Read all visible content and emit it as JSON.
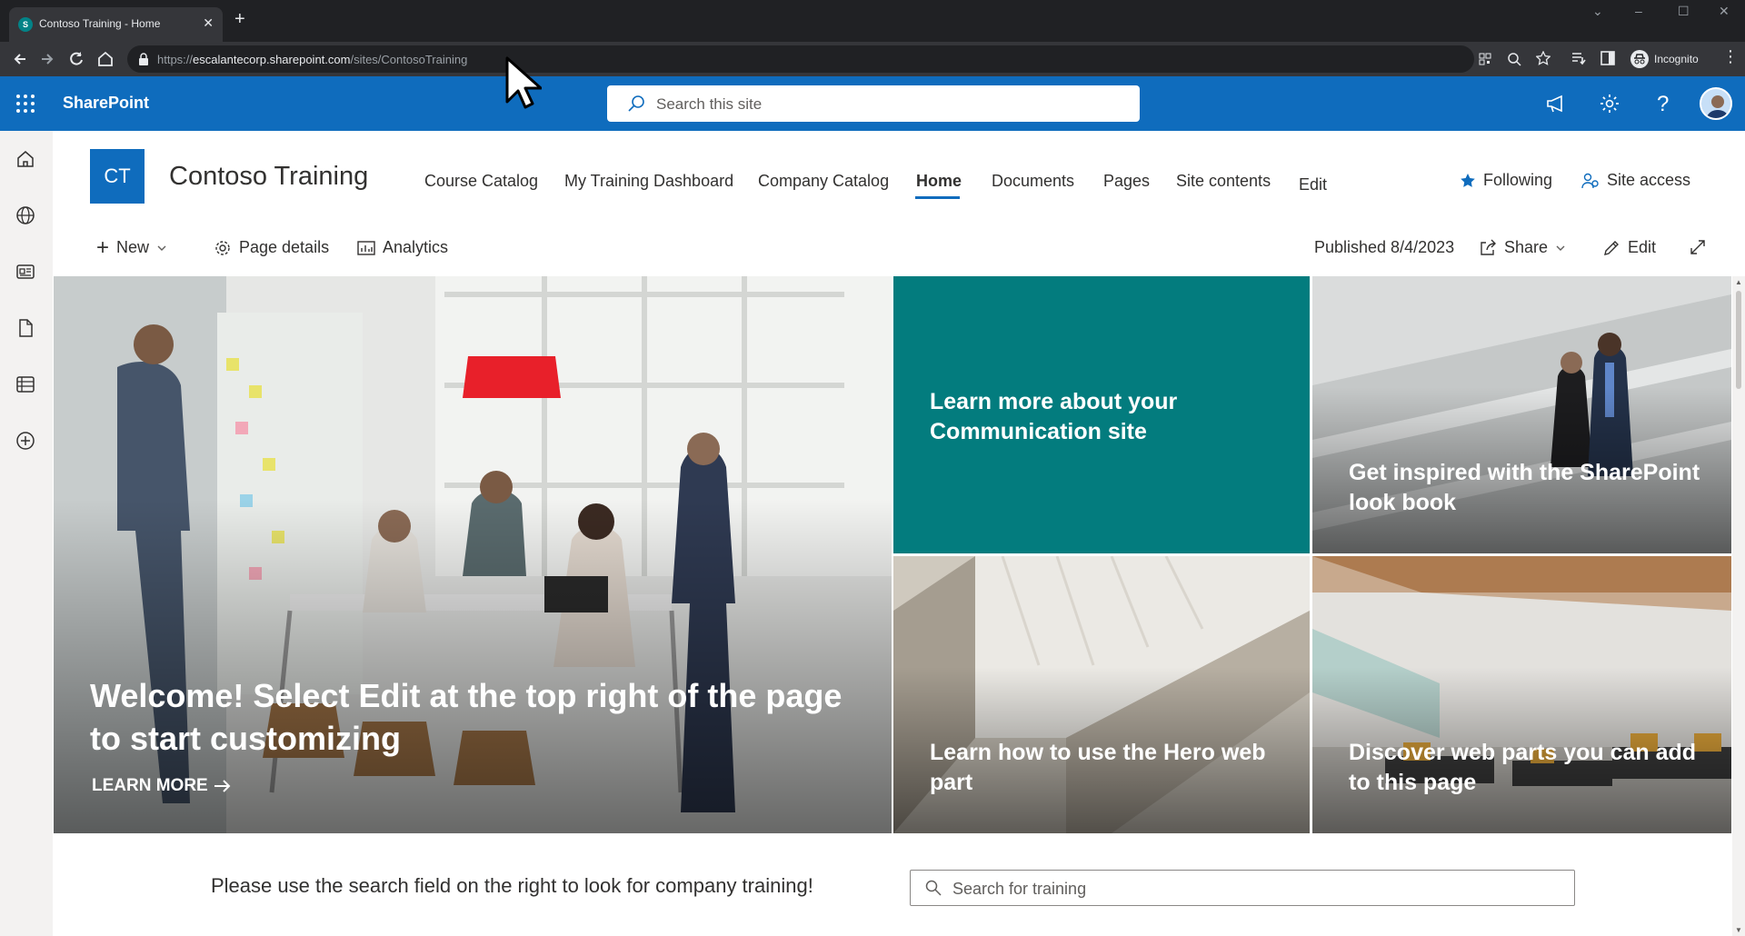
{
  "browser": {
    "tab_title": "Contoso Training - Home",
    "tab_favicon_text": "S",
    "url_prefix": "https://",
    "url_host": "escalantecorp.sharepoint.com",
    "url_path": "/sites/ContosoTraining",
    "profile_label": "Incognito"
  },
  "suitebar": {
    "brand": "SharePoint",
    "search_placeholder": "Search this site"
  },
  "site": {
    "logo_initials": "CT",
    "title": "Contoso Training",
    "nav": [
      {
        "label": "Course Catalog"
      },
      {
        "label": "My Training Dashboard"
      },
      {
        "label": "Company Catalog"
      },
      {
        "label": "Home",
        "active": true
      },
      {
        "label": "Documents"
      },
      {
        "label": "Pages"
      },
      {
        "label": "Site contents"
      },
      {
        "label": "Edit"
      }
    ],
    "following_label": "Following",
    "site_access_label": "Site access"
  },
  "commandbar": {
    "new_label": "New",
    "page_details_label": "Page details",
    "analytics_label": "Analytics",
    "published_label": "Published 8/4/2023",
    "share_label": "Share",
    "edit_label": "Edit"
  },
  "hero": {
    "main_title": "Welcome! Select Edit at the top right of the page to start customizing",
    "main_link": "LEARN MORE",
    "tiles": [
      {
        "caption": "Learn more about your Communication site"
      },
      {
        "caption": "Get inspired with the SharePoint look book"
      },
      {
        "caption": "Learn how to use the Hero web part"
      },
      {
        "caption": "Discover web parts you can add to this page"
      }
    ]
  },
  "content": {
    "instruction": "Please use the search field on the right to look for company training!",
    "training_search_placeholder": "Search for training"
  },
  "colors": {
    "suite_blue": "#0f6cbd",
    "teal_tile": "#037c7e",
    "browser_dark": "#202124"
  }
}
